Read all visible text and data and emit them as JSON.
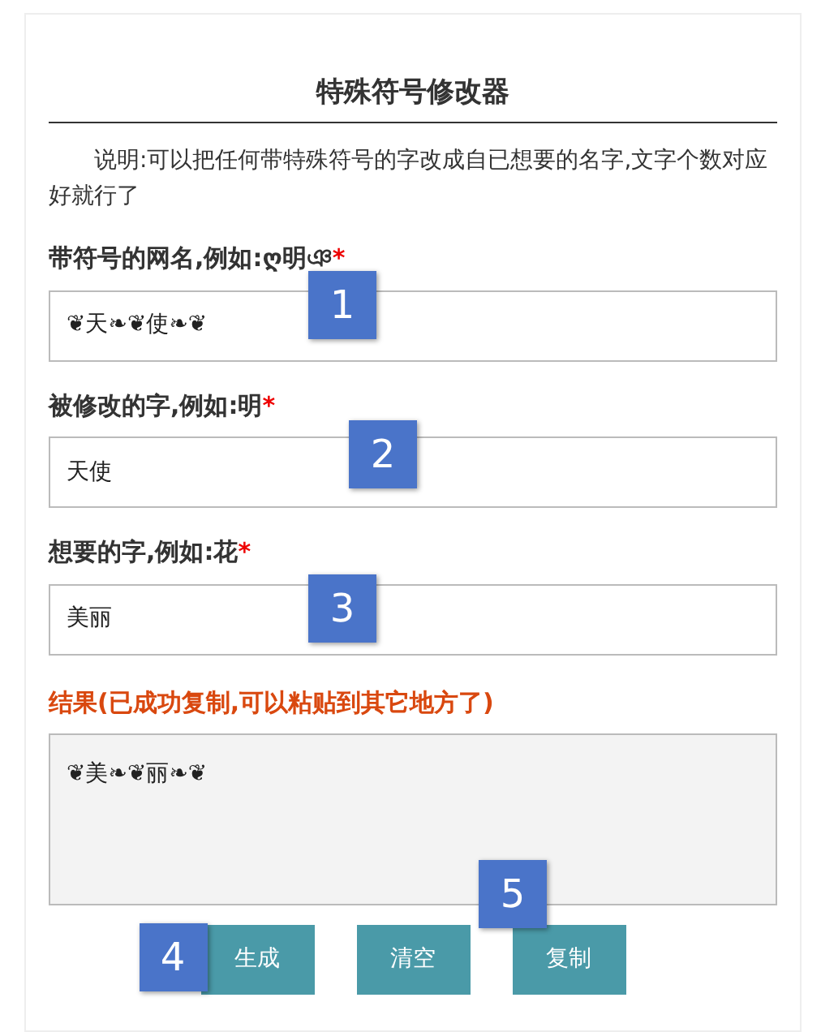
{
  "title": "特殊符号修改器",
  "description": "说明:可以把任何带特殊符号的字改成自已想要的名字,文字个数对应好就行了",
  "fields": [
    {
      "label": "带符号的网名,例如:ღ明ঞ",
      "required_mark": "*",
      "value": "❦天❧❦使❧❦",
      "marker": "1"
    },
    {
      "label": "被修改的字,例如:明",
      "required_mark": "*",
      "value": "天使",
      "marker": "2"
    },
    {
      "label": "想要的字,例如:花",
      "required_mark": "*",
      "value": "美丽",
      "marker": "3"
    }
  ],
  "result": {
    "label": "结果(已成功复制,可以粘贴到其它地方了)",
    "value": "❦美❧❦丽❧❦",
    "marker": "5"
  },
  "buttons": [
    {
      "label": "生成",
      "marker": "4"
    },
    {
      "label": "清空"
    },
    {
      "label": "复制"
    }
  ]
}
